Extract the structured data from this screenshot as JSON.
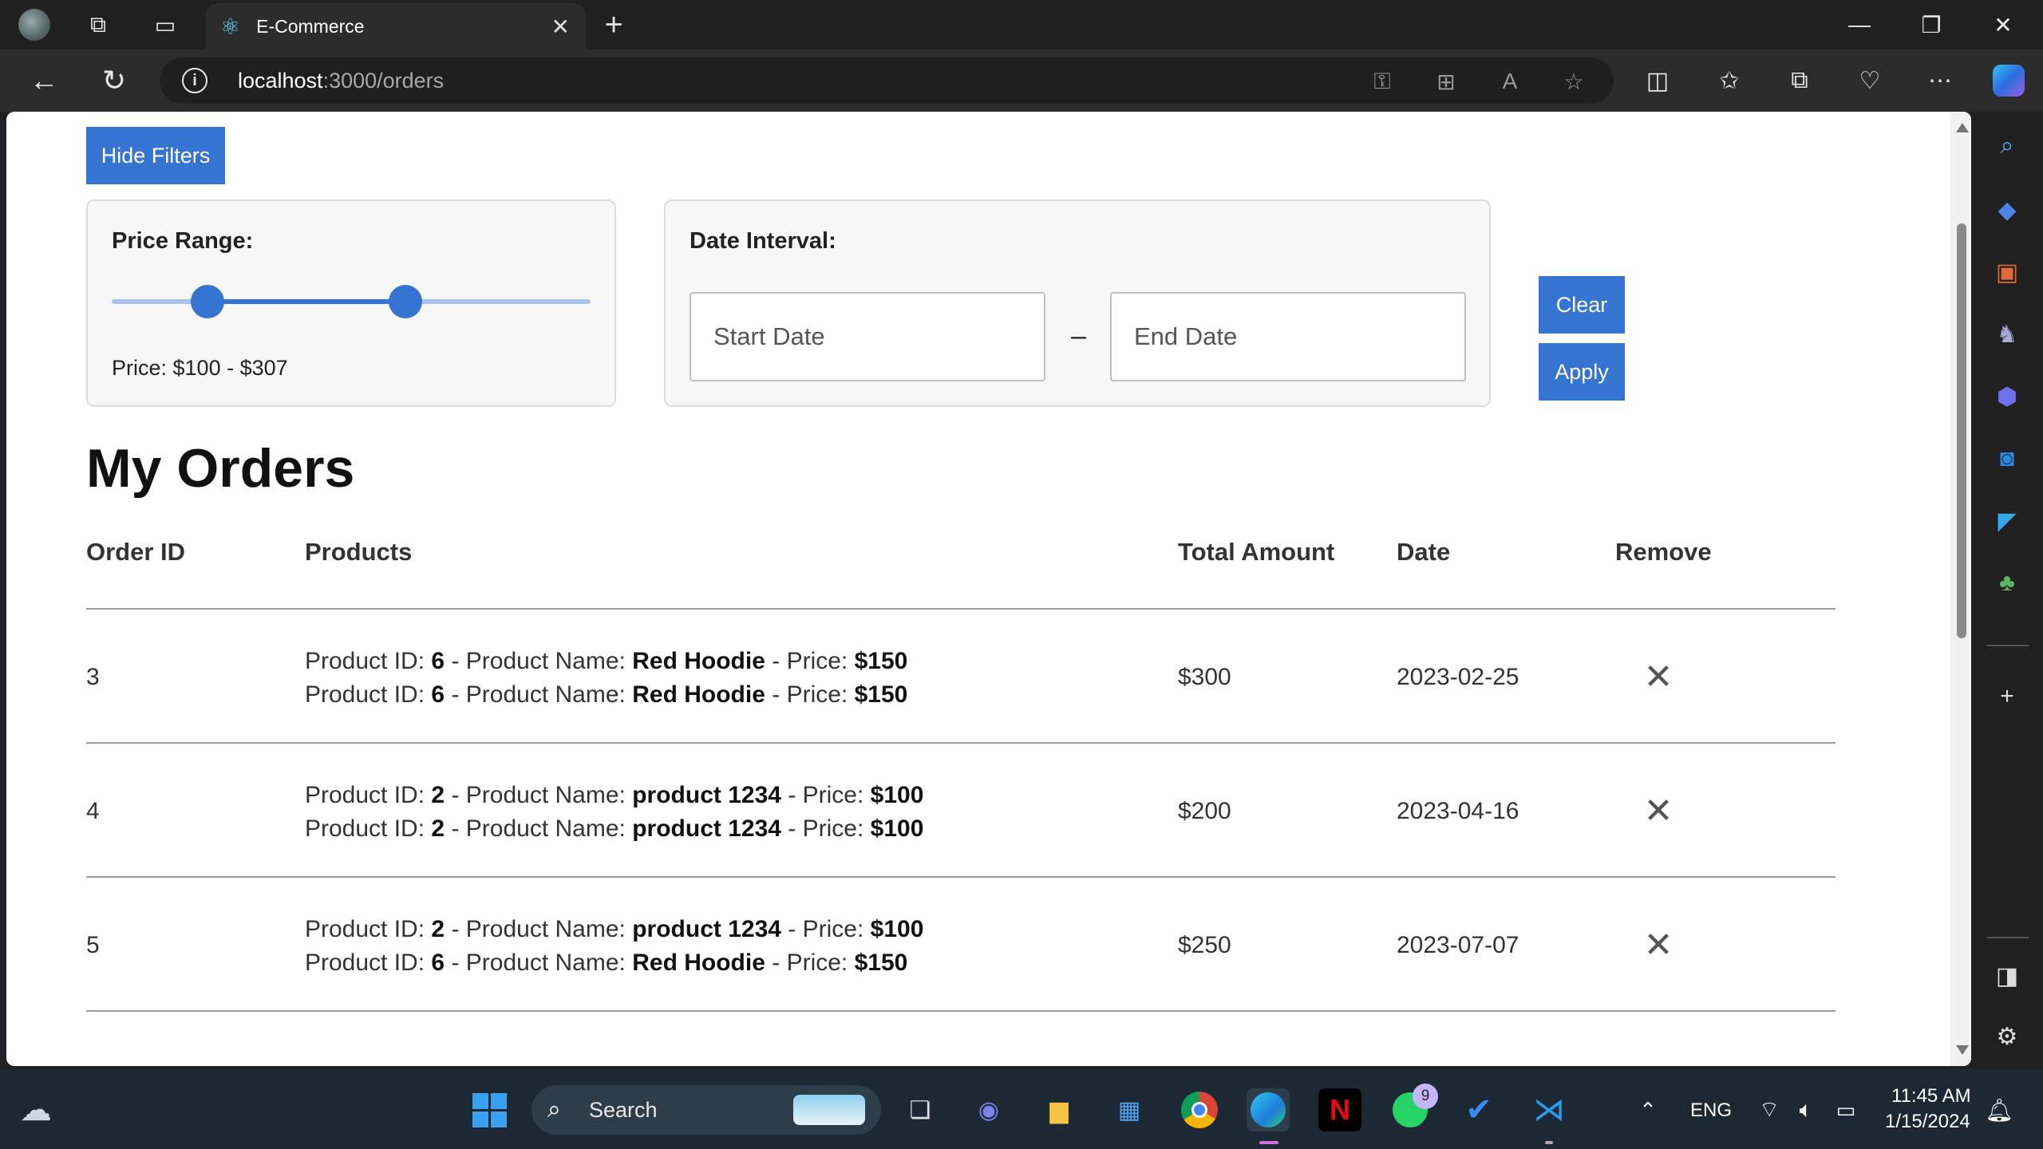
{
  "browser": {
    "tab_title": "E-Commerce",
    "url_host": "localhost",
    "url_path": ":3000/orders"
  },
  "filters": {
    "toggle_label": "Hide Filters",
    "price_label": "Price Range:",
    "price_text": "Price: $100 - $307",
    "price_slider": {
      "min_fraction": 0.2,
      "max_fraction": 0.614
    },
    "date_label": "Date Interval:",
    "start_placeholder": "Start Date",
    "date_separator": "–",
    "end_placeholder": "End Date",
    "clear_label": "Clear",
    "apply_label": "Apply"
  },
  "page_title": "My Orders",
  "table": {
    "headers": [
      "Order ID",
      "Products",
      "Total Amount",
      "Date",
      "Remove"
    ],
    "product_labels": {
      "id": "Product ID:",
      "name": "Product Name:",
      "price": "Price:",
      "sep": "-"
    },
    "rows": [
      {
        "order_id": "3",
        "products": [
          {
            "id": "6",
            "name": "Red Hoodie",
            "price": "$150"
          },
          {
            "id": "6",
            "name": "Red Hoodie",
            "price": "$150"
          }
        ],
        "total": "$300",
        "date": "2023-02-25"
      },
      {
        "order_id": "4",
        "products": [
          {
            "id": "2",
            "name": "product 1234",
            "price": "$100"
          },
          {
            "id": "2",
            "name": "product 1234",
            "price": "$100"
          }
        ],
        "total": "$200",
        "date": "2023-04-16"
      },
      {
        "order_id": "5",
        "products": [
          {
            "id": "2",
            "name": "product 1234",
            "price": "$100"
          },
          {
            "id": "6",
            "name": "Red Hoodie",
            "price": "$150"
          }
        ],
        "total": "$250",
        "date": "2023-07-07"
      }
    ]
  },
  "taskbar": {
    "search_label": "Search",
    "language": "ENG",
    "time": "11:45 AM",
    "date": "1/15/2024",
    "whatsapp_badge": "9"
  },
  "colors": {
    "accent": "#3674d1",
    "slider_track": "#a9c3ee",
    "titlebar": "#202020",
    "taskbar": "#1c2935"
  }
}
